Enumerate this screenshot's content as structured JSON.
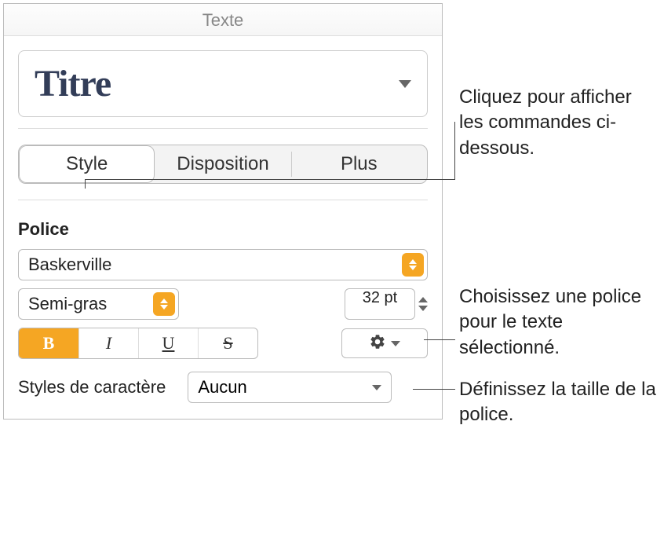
{
  "header": {
    "title": "Texte"
  },
  "style_preview": {
    "label": "Titre"
  },
  "tabs": {
    "style": "Style",
    "layout": "Disposition",
    "more": "Plus"
  },
  "font": {
    "section_label": "Police",
    "family": "Baskerville",
    "weight": "Semi-gras",
    "size": "32 pt",
    "char_styles_label": "Styles de caractère",
    "char_style_value": "Aucun"
  },
  "glyphs": {
    "bold": "B",
    "italic": "I",
    "underline": "U",
    "strike": "S"
  },
  "callouts": {
    "tabs": "Cliquez pour afficher les commandes ci-dessous.",
    "font": "Choisissez une police pour le texte sélectionné.",
    "size": "Définissez la taille de la police."
  }
}
